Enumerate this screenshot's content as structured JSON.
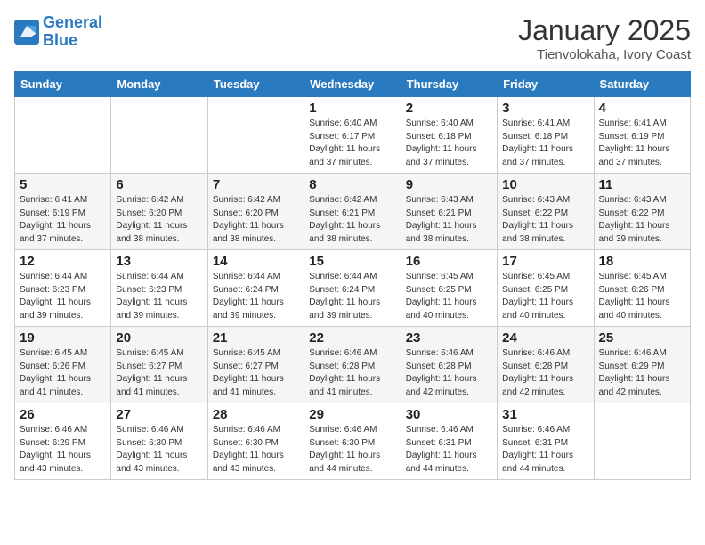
{
  "header": {
    "logo_line1": "General",
    "logo_line2": "Blue",
    "month_title": "January 2025",
    "location": "Tienvolokaha, Ivory Coast"
  },
  "weekdays": [
    "Sunday",
    "Monday",
    "Tuesday",
    "Wednesday",
    "Thursday",
    "Friday",
    "Saturday"
  ],
  "weeks": [
    [
      null,
      null,
      null,
      {
        "day": "1",
        "sunrise": "6:40 AM",
        "sunset": "6:17 PM",
        "daylight": "11 hours and 37 minutes."
      },
      {
        "day": "2",
        "sunrise": "6:40 AM",
        "sunset": "6:18 PM",
        "daylight": "11 hours and 37 minutes."
      },
      {
        "day": "3",
        "sunrise": "6:41 AM",
        "sunset": "6:18 PM",
        "daylight": "11 hours and 37 minutes."
      },
      {
        "day": "4",
        "sunrise": "6:41 AM",
        "sunset": "6:19 PM",
        "daylight": "11 hours and 37 minutes."
      }
    ],
    [
      {
        "day": "5",
        "sunrise": "6:41 AM",
        "sunset": "6:19 PM",
        "daylight": "11 hours and 37 minutes."
      },
      {
        "day": "6",
        "sunrise": "6:42 AM",
        "sunset": "6:20 PM",
        "daylight": "11 hours and 38 minutes."
      },
      {
        "day": "7",
        "sunrise": "6:42 AM",
        "sunset": "6:20 PM",
        "daylight": "11 hours and 38 minutes."
      },
      {
        "day": "8",
        "sunrise": "6:42 AM",
        "sunset": "6:21 PM",
        "daylight": "11 hours and 38 minutes."
      },
      {
        "day": "9",
        "sunrise": "6:43 AM",
        "sunset": "6:21 PM",
        "daylight": "11 hours and 38 minutes."
      },
      {
        "day": "10",
        "sunrise": "6:43 AM",
        "sunset": "6:22 PM",
        "daylight": "11 hours and 38 minutes."
      },
      {
        "day": "11",
        "sunrise": "6:43 AM",
        "sunset": "6:22 PM",
        "daylight": "11 hours and 39 minutes."
      }
    ],
    [
      {
        "day": "12",
        "sunrise": "6:44 AM",
        "sunset": "6:23 PM",
        "daylight": "11 hours and 39 minutes."
      },
      {
        "day": "13",
        "sunrise": "6:44 AM",
        "sunset": "6:23 PM",
        "daylight": "11 hours and 39 minutes."
      },
      {
        "day": "14",
        "sunrise": "6:44 AM",
        "sunset": "6:24 PM",
        "daylight": "11 hours and 39 minutes."
      },
      {
        "day": "15",
        "sunrise": "6:44 AM",
        "sunset": "6:24 PM",
        "daylight": "11 hours and 39 minutes."
      },
      {
        "day": "16",
        "sunrise": "6:45 AM",
        "sunset": "6:25 PM",
        "daylight": "11 hours and 40 minutes."
      },
      {
        "day": "17",
        "sunrise": "6:45 AM",
        "sunset": "6:25 PM",
        "daylight": "11 hours and 40 minutes."
      },
      {
        "day": "18",
        "sunrise": "6:45 AM",
        "sunset": "6:26 PM",
        "daylight": "11 hours and 40 minutes."
      }
    ],
    [
      {
        "day": "19",
        "sunrise": "6:45 AM",
        "sunset": "6:26 PM",
        "daylight": "11 hours and 41 minutes."
      },
      {
        "day": "20",
        "sunrise": "6:45 AM",
        "sunset": "6:27 PM",
        "daylight": "11 hours and 41 minutes."
      },
      {
        "day": "21",
        "sunrise": "6:45 AM",
        "sunset": "6:27 PM",
        "daylight": "11 hours and 41 minutes."
      },
      {
        "day": "22",
        "sunrise": "6:46 AM",
        "sunset": "6:28 PM",
        "daylight": "11 hours and 41 minutes."
      },
      {
        "day": "23",
        "sunrise": "6:46 AM",
        "sunset": "6:28 PM",
        "daylight": "11 hours and 42 minutes."
      },
      {
        "day": "24",
        "sunrise": "6:46 AM",
        "sunset": "6:28 PM",
        "daylight": "11 hours and 42 minutes."
      },
      {
        "day": "25",
        "sunrise": "6:46 AM",
        "sunset": "6:29 PM",
        "daylight": "11 hours and 42 minutes."
      }
    ],
    [
      {
        "day": "26",
        "sunrise": "6:46 AM",
        "sunset": "6:29 PM",
        "daylight": "11 hours and 43 minutes."
      },
      {
        "day": "27",
        "sunrise": "6:46 AM",
        "sunset": "6:30 PM",
        "daylight": "11 hours and 43 minutes."
      },
      {
        "day": "28",
        "sunrise": "6:46 AM",
        "sunset": "6:30 PM",
        "daylight": "11 hours and 43 minutes."
      },
      {
        "day": "29",
        "sunrise": "6:46 AM",
        "sunset": "6:30 PM",
        "daylight": "11 hours and 44 minutes."
      },
      {
        "day": "30",
        "sunrise": "6:46 AM",
        "sunset": "6:31 PM",
        "daylight": "11 hours and 44 minutes."
      },
      {
        "day": "31",
        "sunrise": "6:46 AM",
        "sunset": "6:31 PM",
        "daylight": "11 hours and 44 minutes."
      },
      null
    ]
  ],
  "labels": {
    "sunrise_label": "Sunrise:",
    "sunset_label": "Sunset:",
    "daylight_label": "Daylight:"
  }
}
